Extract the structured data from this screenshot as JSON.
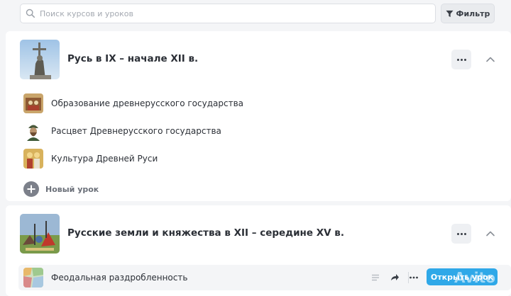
{
  "search": {
    "placeholder": "Поиск курсов и уроков",
    "value": ""
  },
  "filter": {
    "label": "Фильтр"
  },
  "courses": [
    {
      "title": "Русь в IX – начале XII в.",
      "lessons": [
        {
          "label": "Образование древнерусского государства"
        },
        {
          "label": "Расцвет Древнерусского государства"
        },
        {
          "label": "Культура Древней Руси"
        }
      ],
      "new_lesson_label": "Новый урок"
    },
    {
      "title": "Русские земли и княжества в XII – середине XV в.",
      "lessons": [
        {
          "label": "Феодальная раздробленность",
          "open_label": "Открыть урок"
        }
      ]
    }
  ],
  "colors": {
    "accent": "#2fa8e8",
    "background": "#f4f5f7",
    "card": "#ffffff"
  },
  "watermark": "Avito"
}
